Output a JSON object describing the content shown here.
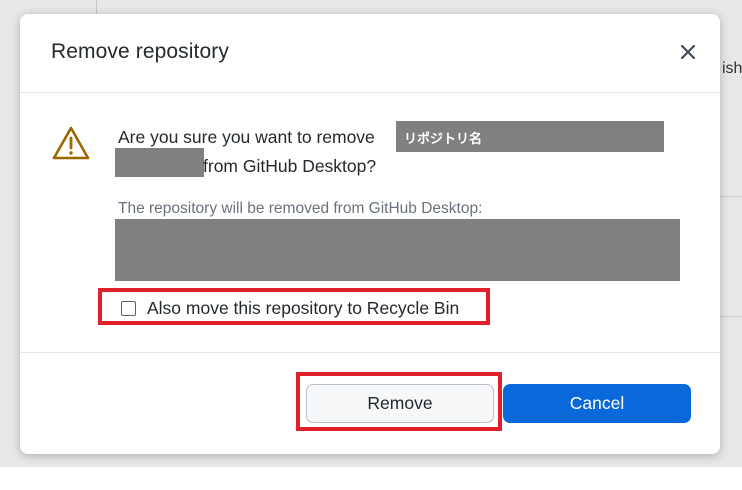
{
  "dialog": {
    "title": "Remove repository",
    "close_icon": "close-icon"
  },
  "message": {
    "line1": "Are you sure you want to remove",
    "repository_name": "リポジトリ名",
    "line2": "from GitHub Desktop?",
    "info": "The repository will be removed from GitHub Desktop:",
    "warning_icon": "warning-triangle-icon",
    "warning_color": "#9a6700"
  },
  "options": {
    "recycle_bin_label": "Also move this repository to Recycle Bin",
    "recycle_bin_checked": false
  },
  "buttons": {
    "remove_label": "Remove",
    "cancel_label": "Cancel",
    "primary_color": "#0969da"
  },
  "background": {
    "partial_text": "ish"
  },
  "colors": {
    "highlight_outline": "#e0202a",
    "redaction": "#808080"
  }
}
